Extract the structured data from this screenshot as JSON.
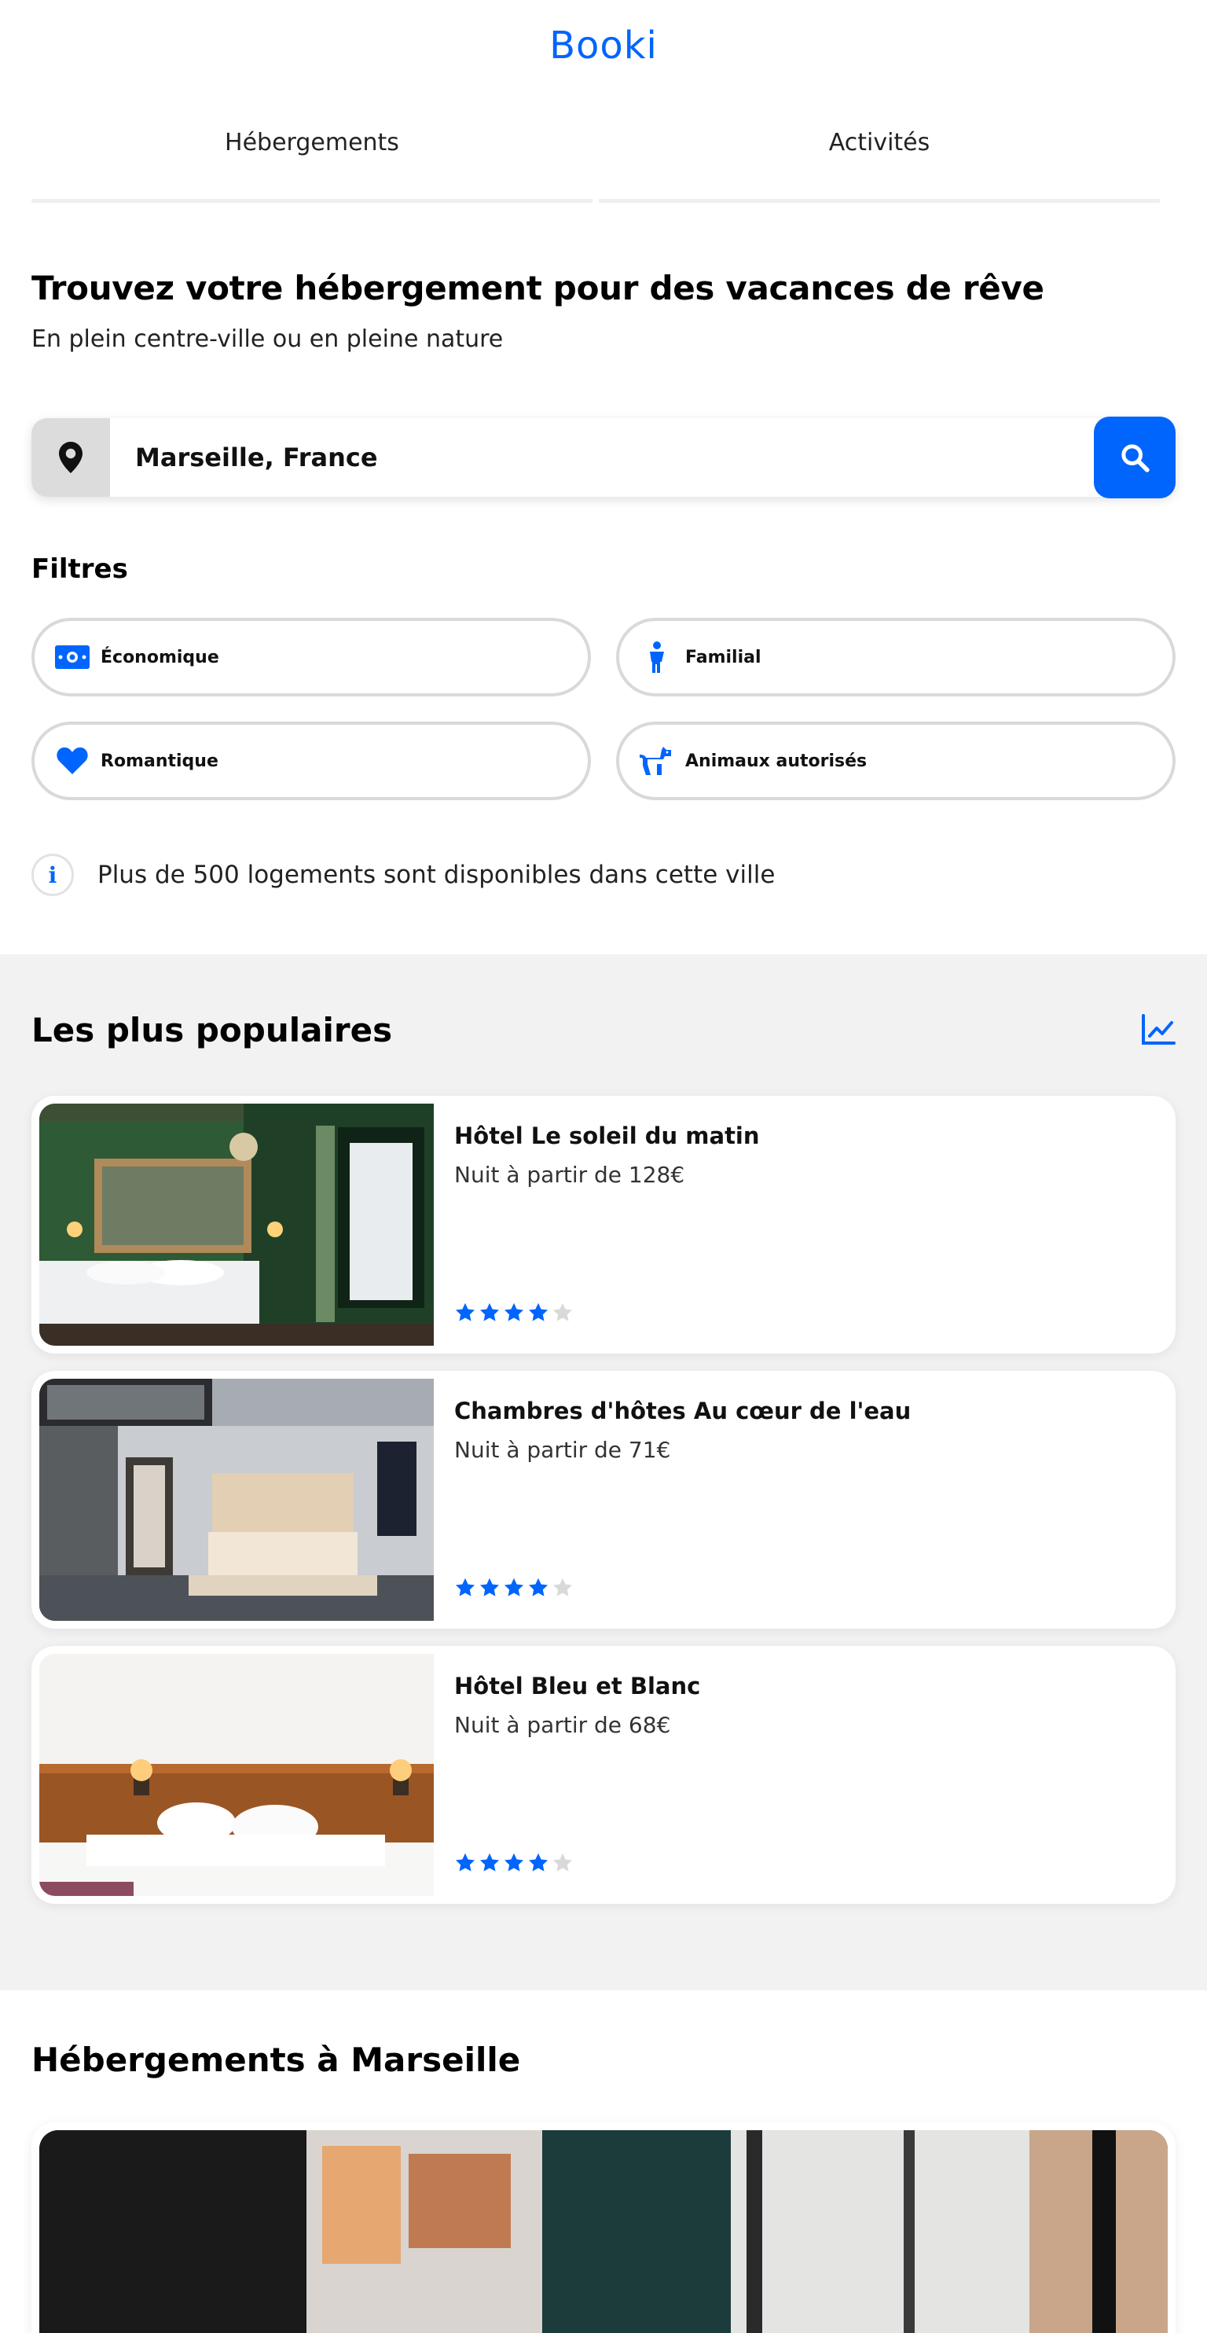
{
  "header": {
    "logo": "Booki",
    "brand_color": "#0065FC"
  },
  "tabs": [
    {
      "label": "Hébergements"
    },
    {
      "label": "Activités"
    }
  ],
  "hero": {
    "title": "Trouvez votre hébergement pour des vacances de rêve",
    "subtitle": "En plein centre-ville ou en pleine nature"
  },
  "search": {
    "value": "Marseille, France",
    "pin_icon": "location-pin-icon",
    "button_icon": "search-icon"
  },
  "filters": {
    "title": "Filtres",
    "items": [
      {
        "label": "Économique",
        "icon": "money-icon"
      },
      {
        "label": "Familial",
        "icon": "child-icon"
      },
      {
        "label": "Romantique",
        "icon": "heart-icon"
      },
      {
        "label": "Animaux autorisés",
        "icon": "dog-icon"
      }
    ]
  },
  "info": {
    "text": "Plus de 500 logements sont disponibles dans cette ville",
    "icon": "info-icon"
  },
  "popular": {
    "title": "Les plus populaires",
    "icon": "trend-chart-icon",
    "items": [
      {
        "name": "Hôtel Le soleil du matin",
        "price": "Nuit à partir de 128€",
        "rating": 4,
        "max_rating": 5
      },
      {
        "name": "Chambres d'hôtes Au cœur de l'eau",
        "price": "Nuit à partir de 71€",
        "rating": 4,
        "max_rating": 5
      },
      {
        "name": "Hôtel Bleu et Blanc",
        "price": "Nuit à partir de 68€",
        "rating": 4,
        "max_rating": 5
      }
    ]
  },
  "marseille": {
    "title": "Hébergements à Marseille"
  },
  "colors": {
    "star_filled": "#0065FC",
    "star_empty": "#D9D9D9",
    "section_bg": "#F2F2F2"
  }
}
